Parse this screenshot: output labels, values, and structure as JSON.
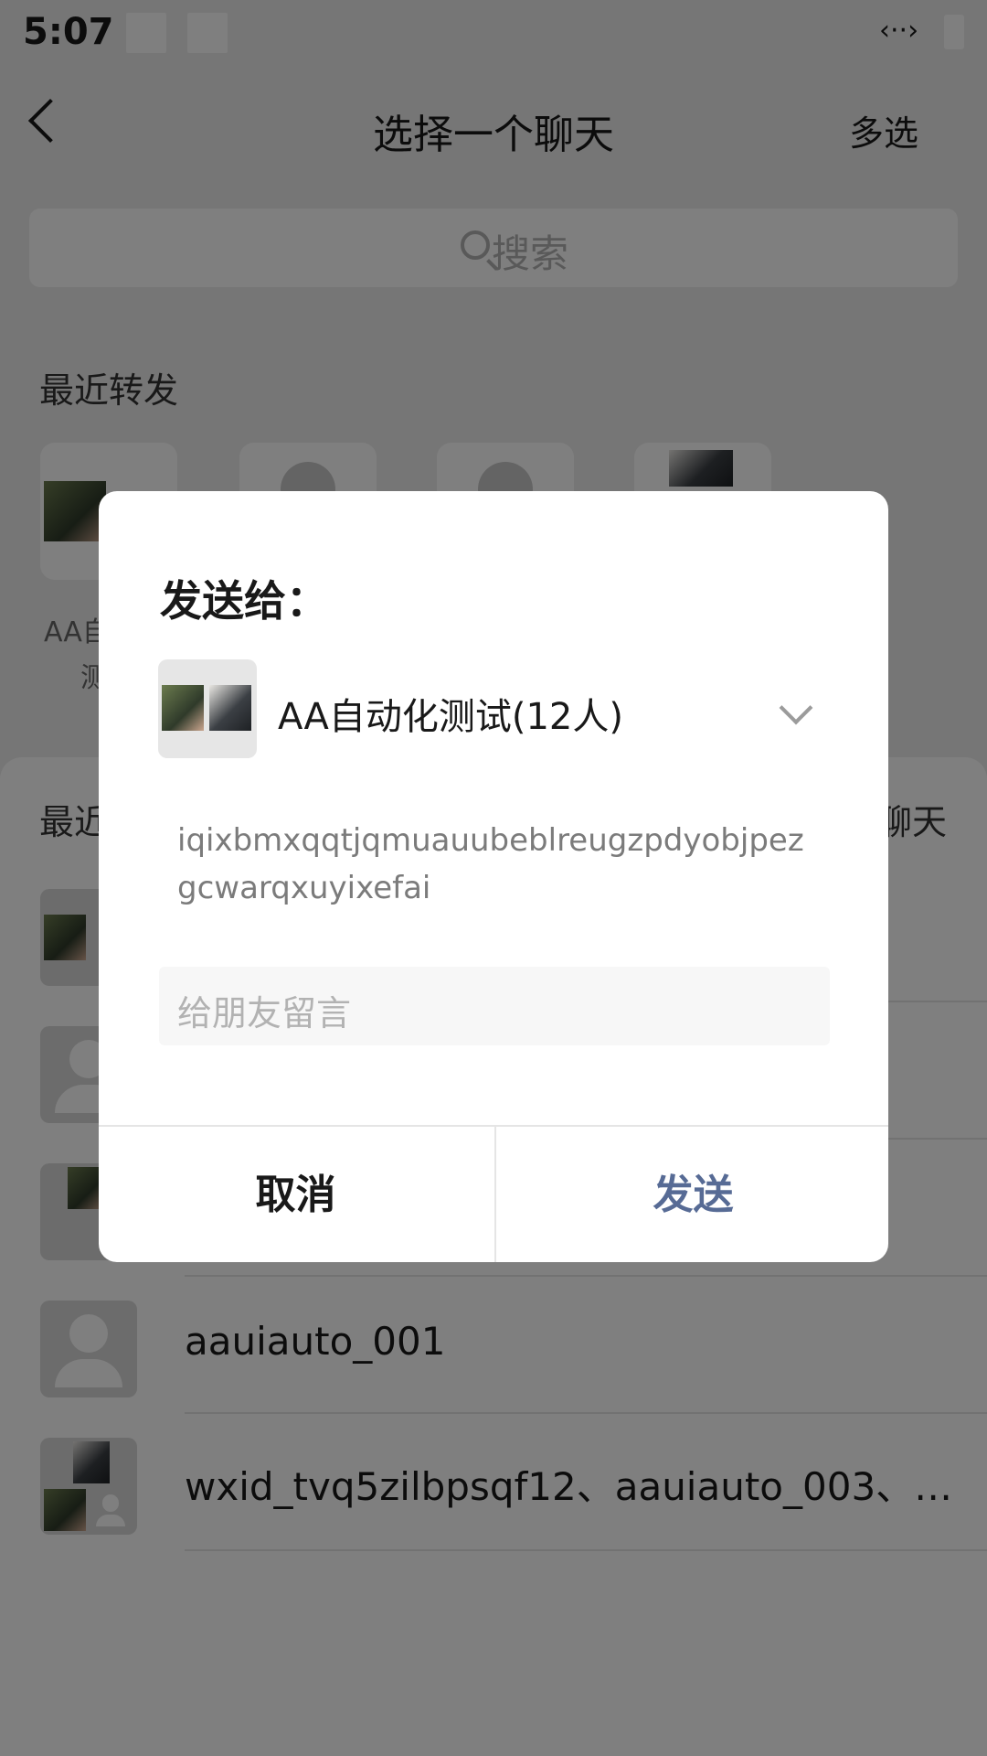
{
  "status_bar": {
    "time": "5:07"
  },
  "header": {
    "title": "选择一个聊天",
    "multi_select": "多选"
  },
  "search": {
    "placeholder": "搜索"
  },
  "recent_forward": {
    "label": "最近转发",
    "items": [
      {
        "name_part1": "AA自",
        "name_part2": "测"
      }
    ]
  },
  "recent_chats": {
    "label": "最近",
    "more_label": "聊天",
    "items": [
      {
        "name": ""
      },
      {
        "name": ""
      },
      {
        "name": ""
      },
      {
        "name": "aauiauto_001"
      },
      {
        "name": "wxid_tvq5zilbpsqf12、aauiauto_003、…"
      }
    ]
  },
  "dialog": {
    "title": "发送给：",
    "target": "AA自动化测试(12人)",
    "message": "iqixbmxqqtjqmuauubeblreugzpdyobjpez gcwarqxuyixefai",
    "input_placeholder": "给朋友留言",
    "cancel": "取消",
    "send": "发送"
  },
  "colors": {
    "accent_send": "#576b95",
    "mask": "rgba(0,0,0,0.5)"
  }
}
